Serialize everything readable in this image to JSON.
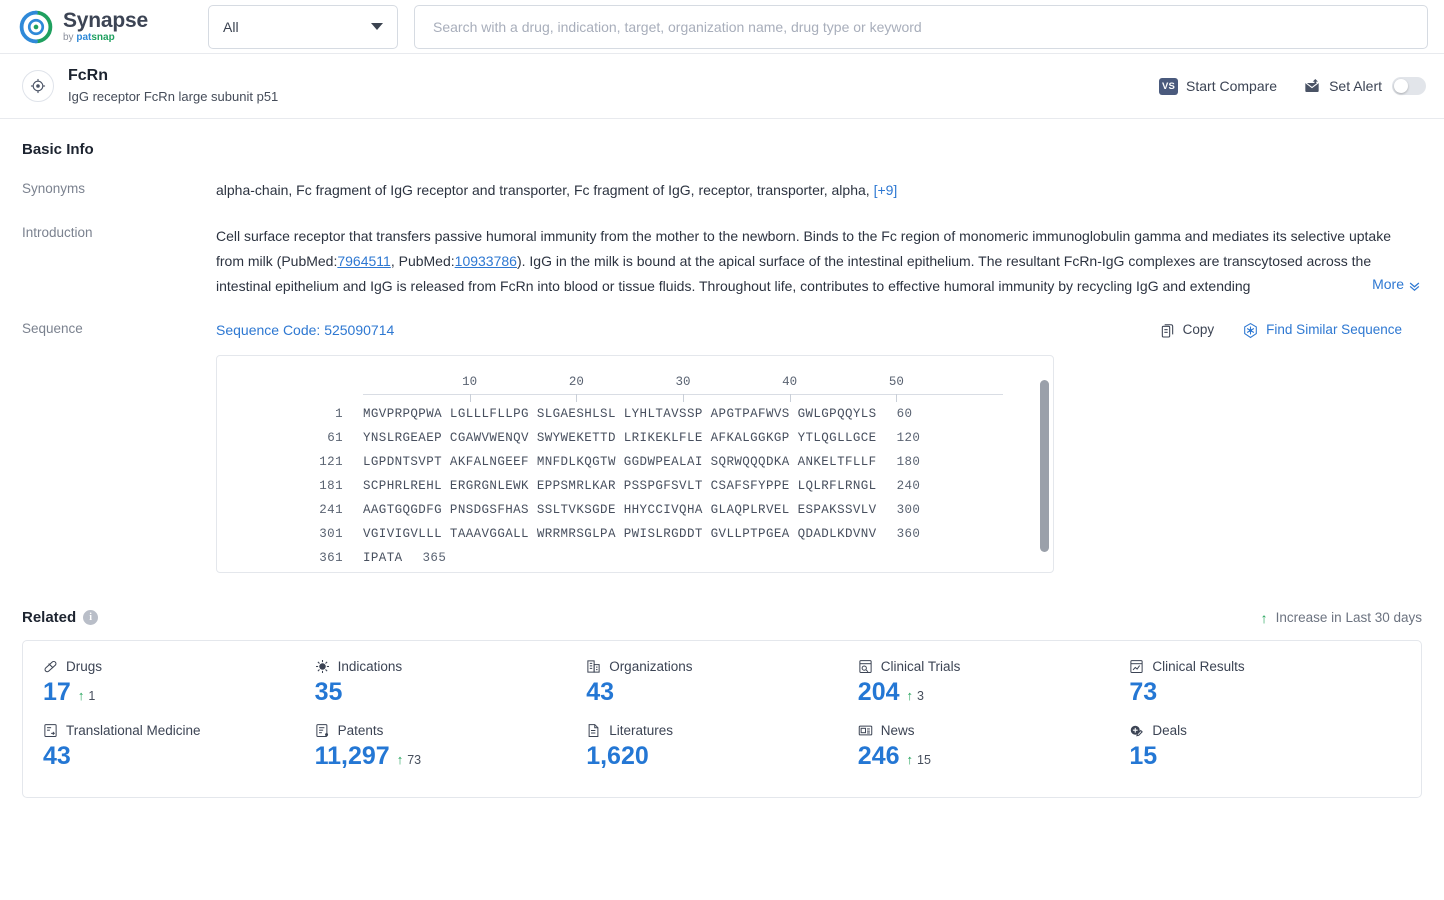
{
  "topbar": {
    "brand_name": "Synapse",
    "brand_by": "by ",
    "brand_pat": "pat",
    "brand_snap": "snap",
    "scope_value": "All",
    "search_placeholder": "Search with a drug, indication, target, organization name, drug type or keyword",
    "search_value": ""
  },
  "entity": {
    "icon": "target-icon",
    "name": "FcRn",
    "subtitle": "IgG receptor FcRn large subunit p51",
    "compare_label": "Start Compare",
    "compare_badge": "VS",
    "alert_label": "Set Alert"
  },
  "basic_info": {
    "title": "Basic Info",
    "synonyms_label": "Synonyms",
    "synonyms_text": "alpha-chain,  Fc fragment of IgG receptor and transporter,  Fc fragment of IgG, receptor, transporter, alpha,",
    "synonyms_more": "[+9]",
    "introduction_label": "Introduction",
    "intro_part1": "Cell surface receptor that transfers passive humoral immunity from the mother to the newborn. Binds to the Fc region of monomeric immunoglobulin gamma and mediates its selective uptake from milk (PubMed:",
    "intro_pmid1": "7964511",
    "intro_part2": ", PubMed:",
    "intro_pmid2": "10933786",
    "intro_part3": "). IgG in the milk is bound at the apical surface of the intestinal epithelium. The resultant FcRn-IgG complexes are transcytosed across the intestinal epithelium and IgG is released from FcRn into blood or tissue fluids. Throughout life, contributes to effective humoral immunity by recycling IgG and extending",
    "more_label": "More"
  },
  "sequence": {
    "label": "Sequence",
    "code_label": "Sequence Code: 525090714",
    "copy_label": "Copy",
    "find_similar_label": "Find Similar Sequence",
    "ruler_ticks": [
      10,
      20,
      30,
      40,
      50
    ],
    "rows": [
      {
        "start": "1",
        "residues": "MGVPRPQPWA LGLLLFLLPG SLGAESHLSL LYHLTAVSSP APGTPAFWVS GWLGPQQYLS",
        "end": "60"
      },
      {
        "start": "61",
        "residues": "YNSLRGEAEP CGAWVWENQV SWYWEKETTD LRIKEKLFLE AFKALGGKGP YTLQGLLGCE",
        "end": "120"
      },
      {
        "start": "121",
        "residues": "LGPDNTSVPT AKFALNGEEF MNFDLKQGTW GGDWPEALAI SQRWQQQDKA ANKELTFLLF",
        "end": "180"
      },
      {
        "start": "181",
        "residues": "SCPHRLREHL ERGRGNLEWK EPPSMRLKAR PSSPGFSVLT CSAFSFYPPE LQLRFLRNGL",
        "end": "240"
      },
      {
        "start": "241",
        "residues": "AAGTGQGDFG PNSDGSFHAS SSLTVKSGDE HHYCCIVQHA GLAQPLRVEL ESPAKSSVLV",
        "end": "300"
      },
      {
        "start": "301",
        "residues": "VGIVIGVLLL TAAAVGGALL WRRMRSGLPA PWISLRGDDT GVLLPTPGEA QDADLKDVNV",
        "end": "360"
      },
      {
        "start": "361",
        "residues": "IPATA",
        "end": "365"
      }
    ]
  },
  "related": {
    "title": "Related",
    "legend_label": "Increase in Last 30 days",
    "stats": [
      {
        "icon": "drug-capsule-icon",
        "label": "Drugs",
        "value": "17",
        "delta": "1"
      },
      {
        "icon": "virus-icon",
        "label": "Indications",
        "value": "35",
        "delta": ""
      },
      {
        "icon": "building-icon",
        "label": "Organizations",
        "value": "43",
        "delta": ""
      },
      {
        "icon": "clinical-trial-icon",
        "label": "Clinical Trials",
        "value": "204",
        "delta": "3"
      },
      {
        "icon": "clinical-result-icon",
        "label": "Clinical Results",
        "value": "73",
        "delta": ""
      },
      {
        "icon": "translational-icon",
        "label": "Translational Medicine",
        "value": "43",
        "delta": ""
      },
      {
        "icon": "patent-icon",
        "label": "Patents",
        "value": "11,297",
        "delta": "73"
      },
      {
        "icon": "literature-icon",
        "label": "Literatures",
        "value": "1,620",
        "delta": ""
      },
      {
        "icon": "news-icon",
        "label": "News",
        "value": "246",
        "delta": "15"
      },
      {
        "icon": "deal-icon",
        "label": "Deals",
        "value": "15",
        "delta": ""
      }
    ]
  },
  "colors": {
    "accent_blue": "#2477d4",
    "link_blue": "#2e78d2",
    "increase_green": "#22a35a",
    "brand_green": "#1fa05f"
  }
}
